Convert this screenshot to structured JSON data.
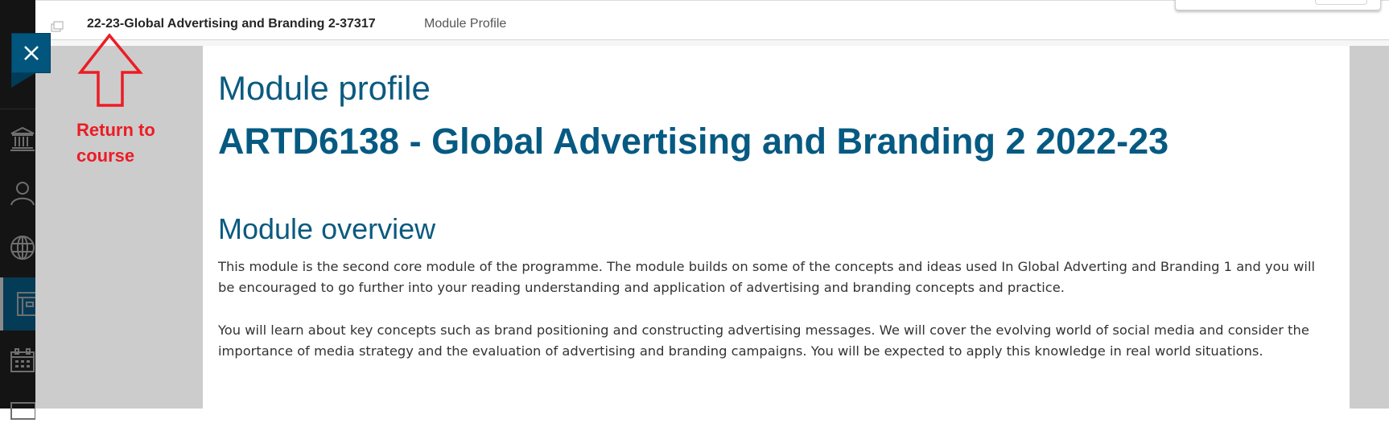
{
  "breadcrumb": {
    "course_title": "22-23-Global Advertising and Branding 2-37317",
    "current_page": "Module Profile"
  },
  "close_button": {
    "label": "×",
    "icon": "close-icon"
  },
  "sidebar": {
    "items": [
      {
        "name": "institution",
        "icon": "institution-icon",
        "active": false
      },
      {
        "name": "profile",
        "icon": "person-icon",
        "active": false
      },
      {
        "name": "activity",
        "icon": "globe-icon",
        "active": false
      },
      {
        "name": "courses",
        "icon": "course-icon",
        "active": true
      },
      {
        "name": "calendar",
        "icon": "calendar-icon",
        "active": false
      },
      {
        "name": "messages",
        "icon": "tray-icon",
        "active": false
      }
    ]
  },
  "annotation": {
    "text": "Return to course",
    "color": "#ec1c24"
  },
  "content": {
    "heading": "Module profile",
    "module_title": "ARTD6138 - Global Advertising and Branding 2 2022-23",
    "section_heading": "Module overview",
    "paragraphs": [
      "This module is the second core module of the programme. The module builds on some of the concepts and ideas used In Global Adverting and Branding 1 and you will be encouraged to go further into your reading understanding and application of advertising and branding concepts and practice.",
      "You will learn about key concepts such as brand positioning and constructing advertising messages. We will cover the evolving world of social media and consider the importance of media strategy and the evaluation of advertising and branding campaigns. You will be expected to apply this knowledge in real world situations."
    ]
  },
  "colors": {
    "accent": "#02567e",
    "heading": "#0b5a80",
    "sidebar_bg": "#141414",
    "stage_bg": "#cccccc"
  }
}
